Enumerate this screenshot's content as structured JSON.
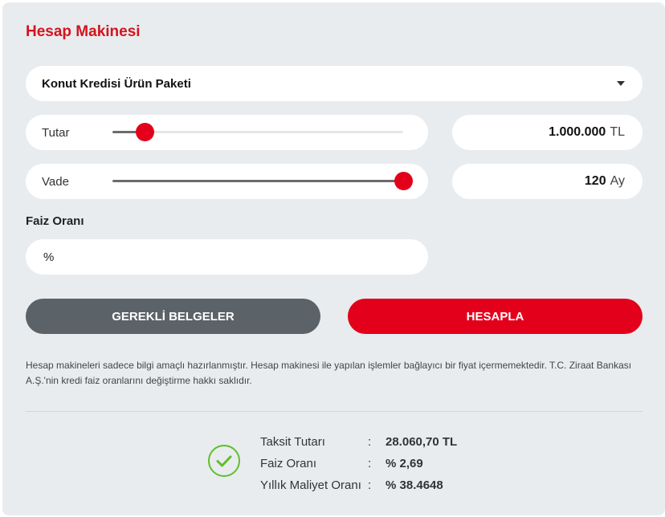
{
  "title": "Hesap Makinesi",
  "product_select": {
    "selected": "Konut Kredisi Ürün Paketi"
  },
  "amount": {
    "label": "Tutar",
    "value": "1.000.000",
    "unit": "TL",
    "slider_fraction": 0.11
  },
  "term": {
    "label": "Vade",
    "value": "120",
    "unit": "Ay",
    "slider_fraction": 1.0
  },
  "interest": {
    "label": "Faiz Oranı",
    "placeholder": "%"
  },
  "buttons": {
    "documents": "GEREKLİ BELGELER",
    "calculate": "HESAPLA"
  },
  "disclaimer": "Hesap makineleri sadece bilgi amaçlı hazırlanmıştır. Hesap makinesi ile yapılan işlemler bağlayıcı bir fiyat içermemektedir. T.C. Ziraat Bankası A.Ş.'nin kredi faiz oranlarını değiştirme hakkı saklıdır.",
  "results": [
    {
      "label": "Taksit Tutarı",
      "value": "28.060,70 TL"
    },
    {
      "label": "Faiz Oranı",
      "value": "% 2,69"
    },
    {
      "label": "Yıllık Maliyet Oranı",
      "value": "% 38.4648"
    }
  ],
  "colors": {
    "brand_red": "#e3001b",
    "title_red": "#d2141e",
    "secondary_button": "#5b6268",
    "success_green": "#5fbf2b",
    "panel_bg": "#e9ecef"
  },
  "icons": {
    "select_caret": "caret-down-icon",
    "result_status": "check-circle-icon"
  }
}
